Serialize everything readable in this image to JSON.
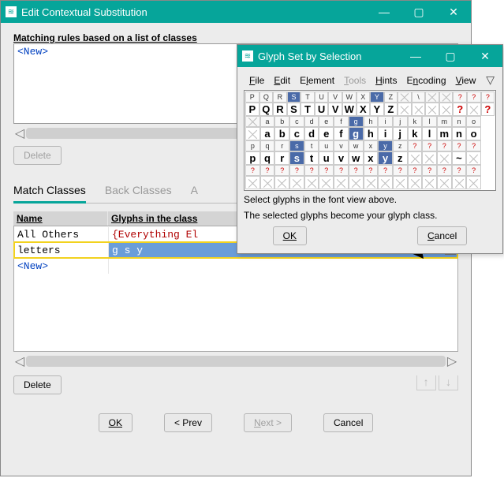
{
  "main": {
    "title": "Edit Contextual Substitution",
    "rules_label": "Matching rules based on a list of classes",
    "new_item": "<New>",
    "delete": "Delete",
    "tabs": {
      "match": "Match Classes",
      "back": "Back Classes",
      "ahead": "A"
    },
    "cols": {
      "name": "Name",
      "glyphs": "Glyphs in the class"
    },
    "rows": [
      {
        "name": "All Others",
        "glyphs": "{Everything El"
      },
      {
        "name": "letters",
        "glyphs": "g s y"
      },
      {
        "name": "<New>",
        "glyphs": ""
      }
    ],
    "footer": {
      "ok": "OK",
      "prev": "< Prev",
      "next": "Next >",
      "cancel": "Cancel"
    },
    "arrows": {
      "up": "↑",
      "down": "↓"
    }
  },
  "popup": {
    "title": "Glyph Set by Selection",
    "menu": {
      "file": "File",
      "edit": "Edit",
      "element": "Element",
      "tools": "Tools",
      "hints": "Hints",
      "encoding": "Encoding",
      "view": "View"
    },
    "grid_top": [
      "P",
      "Q",
      "R",
      "S",
      "T",
      "U",
      "V",
      "W",
      "X",
      "Y",
      "Z",
      "",
      "\\",
      "",
      "",
      "?",
      "?",
      "?"
    ],
    "grid_upper": [
      "P",
      "Q",
      "R",
      "S",
      "T",
      "U",
      "V",
      "W",
      "X",
      "Y",
      "Z",
      "",
      "",
      "",
      "",
      "?",
      "",
      "?"
    ],
    "grid_low_top": [
      "",
      "a",
      "b",
      "c",
      "d",
      "e",
      "f",
      "g",
      "h",
      "i",
      "j",
      "k",
      "l",
      "m",
      "n",
      "o"
    ],
    "grid_low": [
      "",
      "a",
      "b",
      "c",
      "d",
      "e",
      "f",
      "g",
      "h",
      "i",
      "j",
      "k",
      "l",
      "m",
      "n",
      "o"
    ],
    "grid_pz_top": [
      "p",
      "q",
      "r",
      "s",
      "t",
      "u",
      "v",
      "w",
      "x",
      "y",
      "z",
      "?",
      "?",
      "?",
      "?",
      "?"
    ],
    "grid_pz": [
      "p",
      "q",
      "r",
      "s",
      "t",
      "u",
      "v",
      "w",
      "x",
      "y",
      "z",
      "",
      "",
      "",
      "~",
      ""
    ],
    "grid_q": [
      "?",
      "?",
      "?",
      "?",
      "?",
      "?",
      "?",
      "?",
      "?",
      "?",
      "?",
      "?",
      "?",
      "?",
      "?",
      "?"
    ],
    "selected_upper": [
      "S",
      "Y"
    ],
    "selected_lower": [
      "g",
      "s",
      "y"
    ],
    "msg1": "Select glyphs in the font view above.",
    "msg2": "The selected glyphs become your glyph class.",
    "ok": "OK",
    "cancel": "Cancel"
  }
}
